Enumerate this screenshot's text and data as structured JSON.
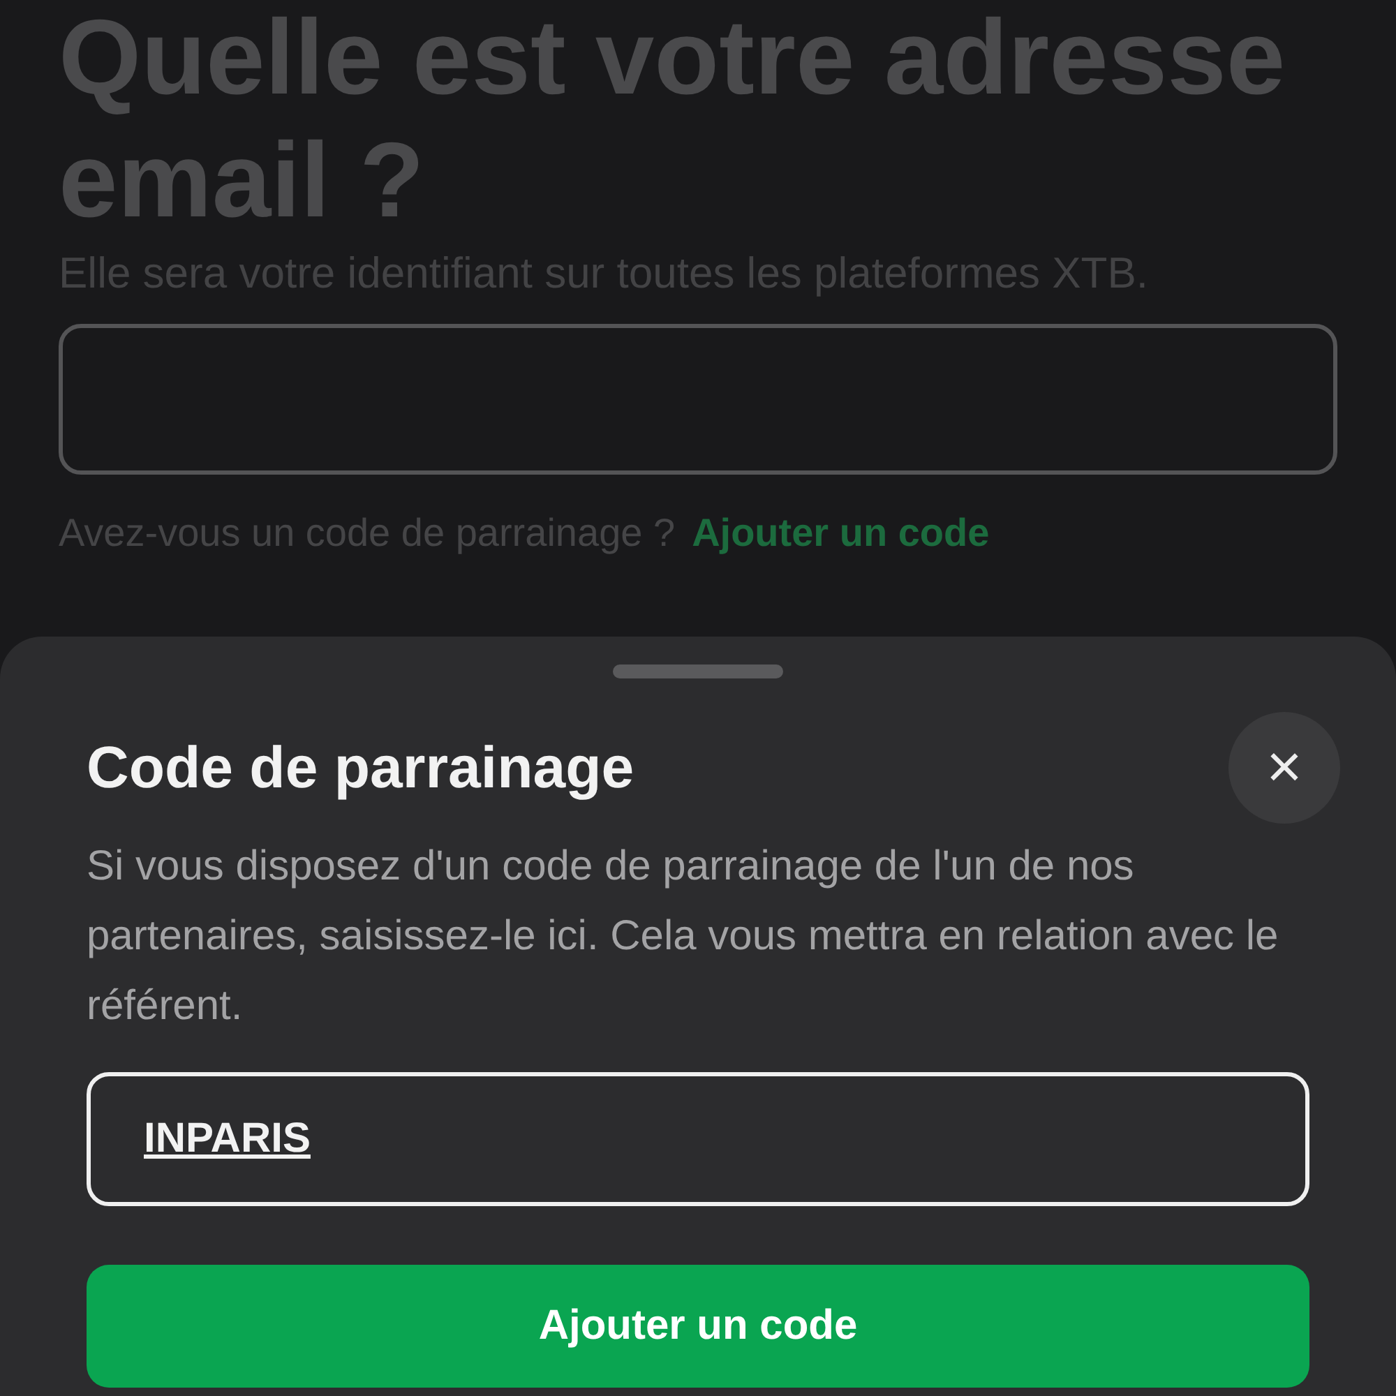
{
  "page": {
    "title": "Quelle est votre adresse email ?",
    "subtitle": "Elle sera votre identifiant sur toutes les plateformes XTB.",
    "referral_question": "Avez-vous un code de parrainage ?",
    "referral_link": "Ajouter un code"
  },
  "sheet": {
    "title": "Code de parrainage",
    "close": "×",
    "description": "Si vous disposez d'un code de parrainage de l'un de nos partenaires, saisissez-le ici. Cela vous mettra en relation avec le référent.",
    "code_value": "INPARIS",
    "button": "Ajouter un code"
  }
}
